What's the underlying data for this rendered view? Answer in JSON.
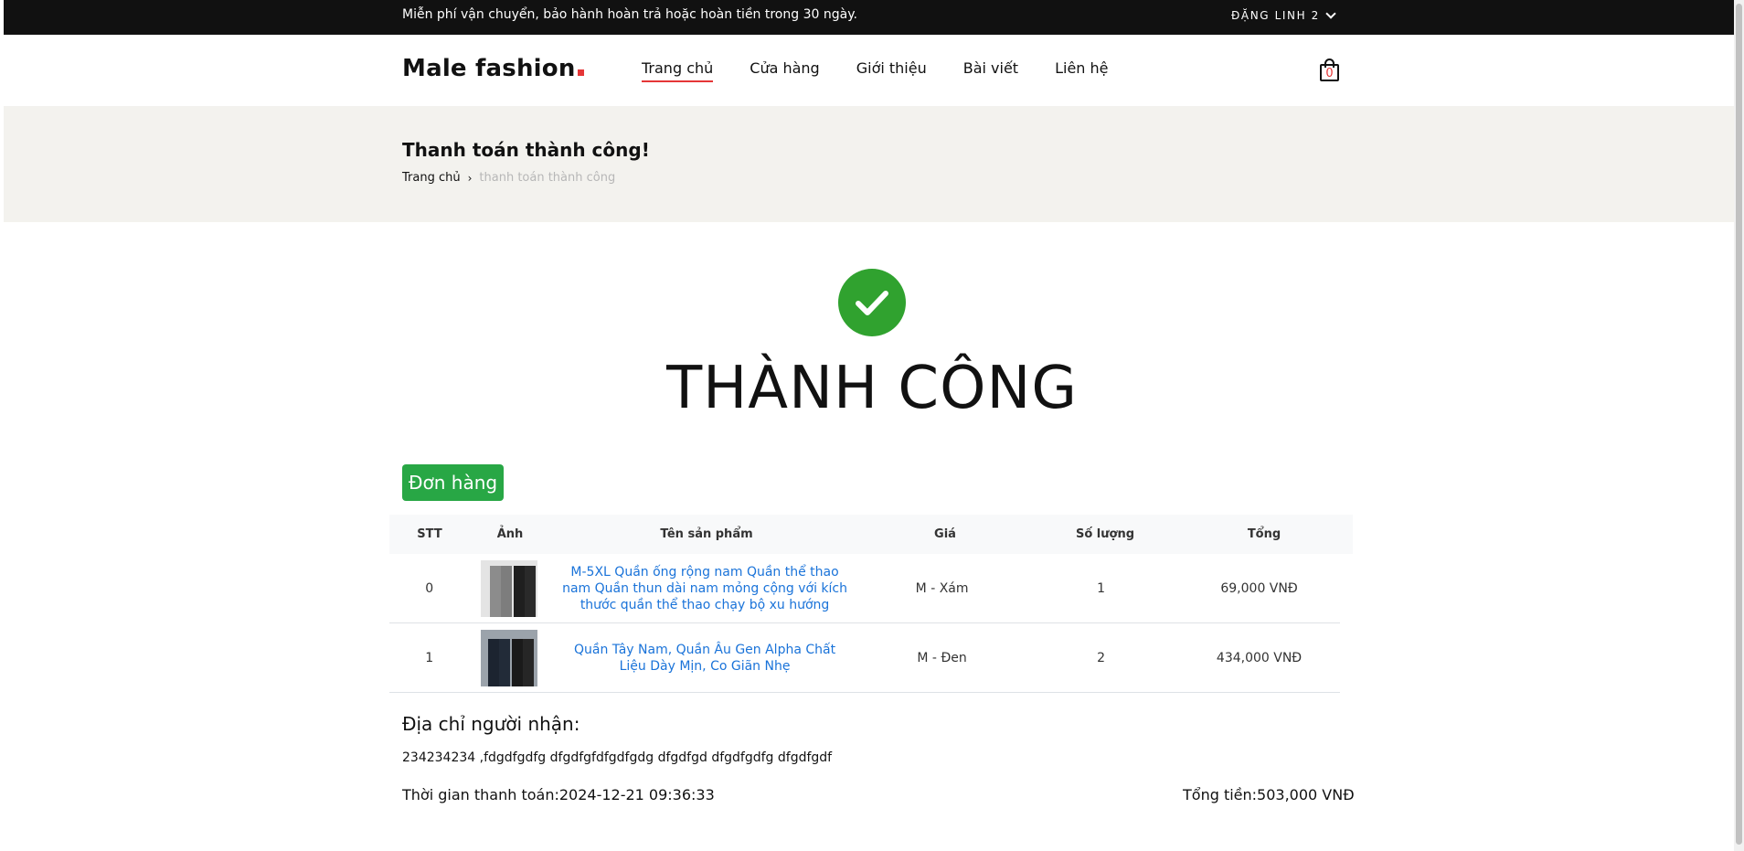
{
  "topbar": {
    "notice": "Miễn phí vận chuyển, bảo hành hoàn trả hoặc hoàn tiền trong 30 ngày.",
    "account": "ĐẶNG LINH 2"
  },
  "header": {
    "logo": "Male fashion",
    "nav": [
      "Trang chủ",
      "Cửa hàng",
      "Giới thiệu",
      "Bài viết",
      "Liên hệ"
    ],
    "cart_count": "0"
  },
  "breadcrumb": {
    "title": "Thanh toán thành công!",
    "home": "Trang chủ",
    "current": "thanh toán thành công"
  },
  "success": {
    "title": "THÀNH CÔNG",
    "orders_button": "Đơn hàng"
  },
  "table": {
    "headers": [
      "STT",
      "Ảnh",
      "Tên sản phẩm",
      "Giá",
      "Số lượng",
      "Tổng"
    ],
    "rows": [
      {
        "stt": "0",
        "name": "M-5XL Quần ống rộng nam Quần thể thao nam Quần thun dài nam mỏng cộng với kích thước quần thể thao chạy bộ xu hướng",
        "price": "M - Xám",
        "qty": "1",
        "total": "69,000 VNĐ"
      },
      {
        "stt": "1",
        "name": "Quần Tây Nam, Quần Âu Gen Alpha Chất Liệu Dày Mịn, Co Giãn Nhẹ",
        "price": "M - Đen",
        "qty": "2",
        "total": "434,000 VNĐ"
      }
    ]
  },
  "order": {
    "address_title": "Địa chỉ người nhận:",
    "address": "234234234 ,fdgdfgdfg dfgdfgfdfgdfgdg dfgdfgd dfgdfgdfg dfgdfgdf",
    "payment_time": "Thời gian thanh toán:2024-12-21 09:36:33",
    "total": "Tổng tiền:503,000 VNĐ"
  }
}
